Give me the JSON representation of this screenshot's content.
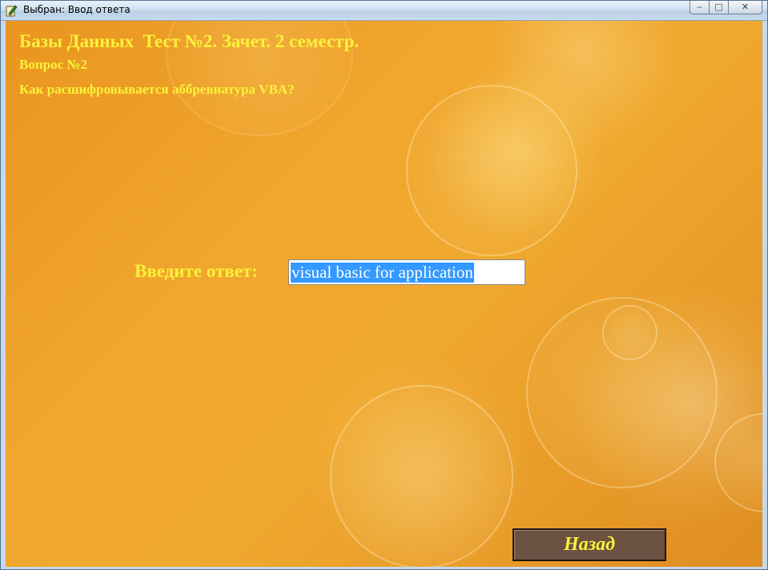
{
  "window": {
    "title": "Выбран: Ввод ответа",
    "minimize_symbol": "‒",
    "maximize_symbol": "□",
    "close_symbol": "✕"
  },
  "test": {
    "heading": "Базы Данных  Тест №2. Зачет. 2 семестр.",
    "question_number": "Вопрос №2",
    "question_text": "Как расшифровывается аббревиатура VBA?"
  },
  "answer": {
    "label": "Введите ответ:",
    "value": "visual basic for application"
  },
  "buttons": {
    "back_label": "Назад"
  },
  "colors": {
    "text_accent": "#fbf23a",
    "background_orange": "#f0a92f",
    "button_brown": "#6b5242",
    "selection_blue": "#3399ff"
  }
}
